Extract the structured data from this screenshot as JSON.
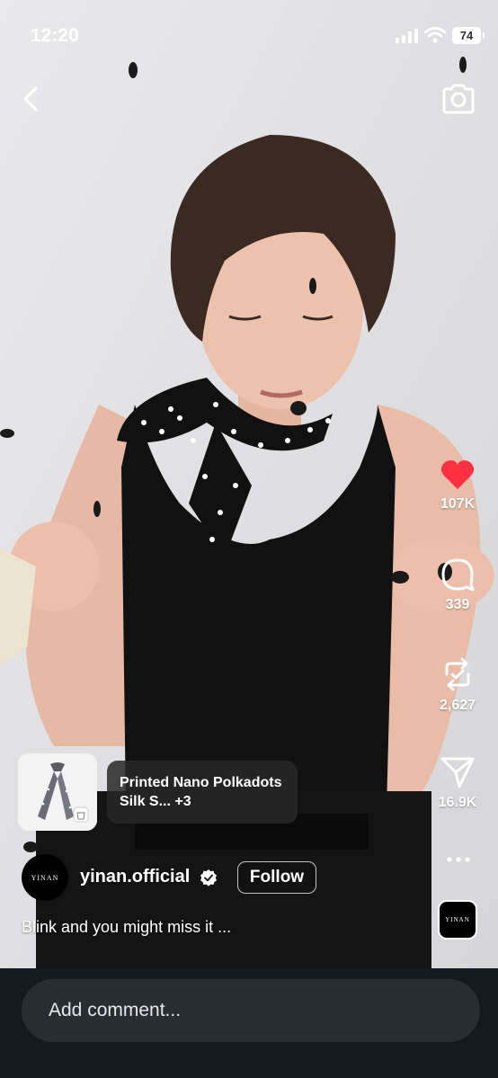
{
  "status_bar": {
    "time": "12:20",
    "battery": "74"
  },
  "actions": {
    "likes": "107K",
    "comments": "339",
    "reposts": "2,627",
    "shares": "16.9K"
  },
  "product": {
    "label": "Printed Nano Polkadots Silk S... +3"
  },
  "account": {
    "username": "yinan.official",
    "follow_label": "Follow",
    "logo_text": "YINAN"
  },
  "caption": "Blink and you might miss it ...",
  "comment_input": {
    "placeholder": "Add comment..."
  },
  "colors": {
    "like_red": "#ff3040",
    "bottom_bar": "#141a1f",
    "input_bg": "#262d33"
  }
}
